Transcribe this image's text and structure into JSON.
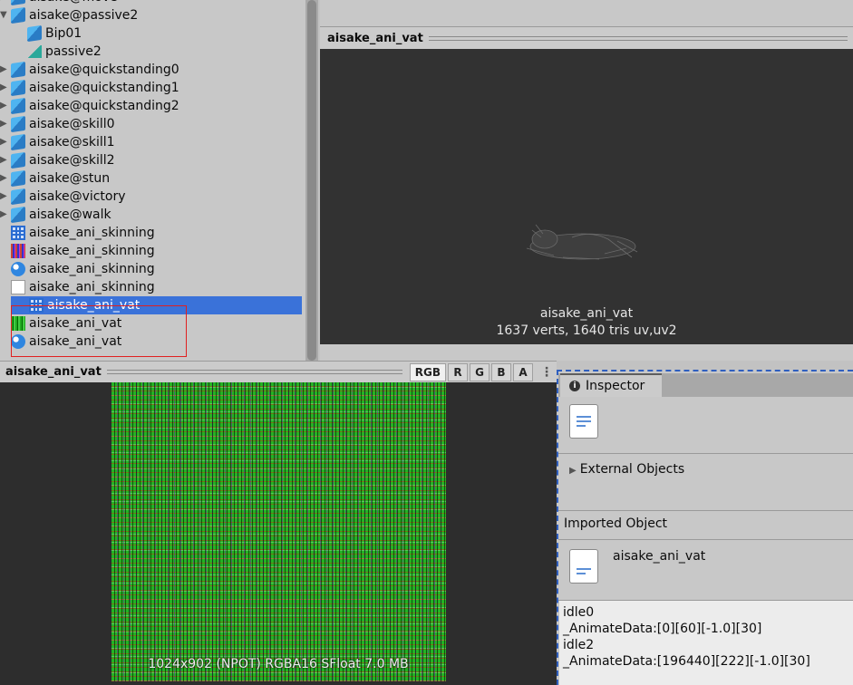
{
  "project_tree": {
    "items": [
      {
        "label": "aisake@move",
        "icon": "prefab-icon",
        "arrow": "right",
        "indent": 0
      },
      {
        "label": "aisake@passive2",
        "icon": "prefab-icon",
        "arrow": "down",
        "indent": 0
      },
      {
        "label": "Bip01",
        "icon": "prefab-icon",
        "arrow": "",
        "indent": 1
      },
      {
        "label": "passive2",
        "icon": "animation-clip-icon",
        "arrow": "",
        "indent": 1
      },
      {
        "label": "aisake@quickstanding0",
        "icon": "prefab-icon",
        "arrow": "right",
        "indent": 0
      },
      {
        "label": "aisake@quickstanding1",
        "icon": "prefab-icon",
        "arrow": "right",
        "indent": 0
      },
      {
        "label": "aisake@quickstanding2",
        "icon": "prefab-icon",
        "arrow": "right",
        "indent": 0
      },
      {
        "label": "aisake@skill0",
        "icon": "prefab-icon",
        "arrow": "right",
        "indent": 0
      },
      {
        "label": "aisake@skill1",
        "icon": "prefab-icon",
        "arrow": "right",
        "indent": 0
      },
      {
        "label": "aisake@skill2",
        "icon": "prefab-icon",
        "arrow": "right",
        "indent": 0
      },
      {
        "label": "aisake@stun",
        "icon": "prefab-icon",
        "arrow": "right",
        "indent": 0
      },
      {
        "label": "aisake@victory",
        "icon": "prefab-icon",
        "arrow": "right",
        "indent": 0
      },
      {
        "label": "aisake@walk",
        "icon": "prefab-icon",
        "arrow": "right",
        "indent": 0
      },
      {
        "label": "aisake_ani_skinning",
        "icon": "mesh-grid-icon",
        "arrow": "",
        "indent": 0
      },
      {
        "label": "aisake_ani_skinning",
        "icon": "texture-noise-icon",
        "arrow": "",
        "indent": 0
      },
      {
        "label": "aisake_ani_skinning",
        "icon": "material-sphere-icon",
        "arrow": "",
        "indent": 0
      },
      {
        "label": "aisake_ani_skinning",
        "icon": "text-asset-icon",
        "arrow": "",
        "indent": 0
      },
      {
        "label": "aisake_ani_vat",
        "icon": "mesh-grid-icon",
        "arrow": "",
        "indent": 0,
        "selected": true
      },
      {
        "label": "aisake_ani_vat",
        "icon": "texture-green-icon",
        "arrow": "",
        "indent": 0
      },
      {
        "label": "aisake_ani_vat",
        "icon": "material-sphere-icon",
        "arrow": "",
        "indent": 0
      }
    ]
  },
  "preview": {
    "title": "aisake_ani_vat",
    "object_name": "aisake_ani_vat",
    "info": "1637 verts, 1640 tris   uv,uv2"
  },
  "texture_preview": {
    "title": "aisake_ani_vat",
    "channels": [
      "RGB",
      "R",
      "G",
      "B",
      "A"
    ],
    "active_channel": "RGB",
    "info": "1024x902 (NPOT)  RGBA16 SFloat   7.0 MB"
  },
  "inspector": {
    "tab_label": "Inspector",
    "external_objects_label": "External Objects",
    "imported_object_label": "Imported Object",
    "object_name": "aisake_ani_vat",
    "text_lines": [
      "idle0",
      "_AnimateData:[0][60][-1.0][30]",
      "idle2",
      "_AnimateData:[196440][222][-1.0][30]"
    ]
  },
  "colors": {
    "selection": "#3a72d9",
    "highlight_box": "#e02020",
    "viewport_bg": "#323232"
  }
}
